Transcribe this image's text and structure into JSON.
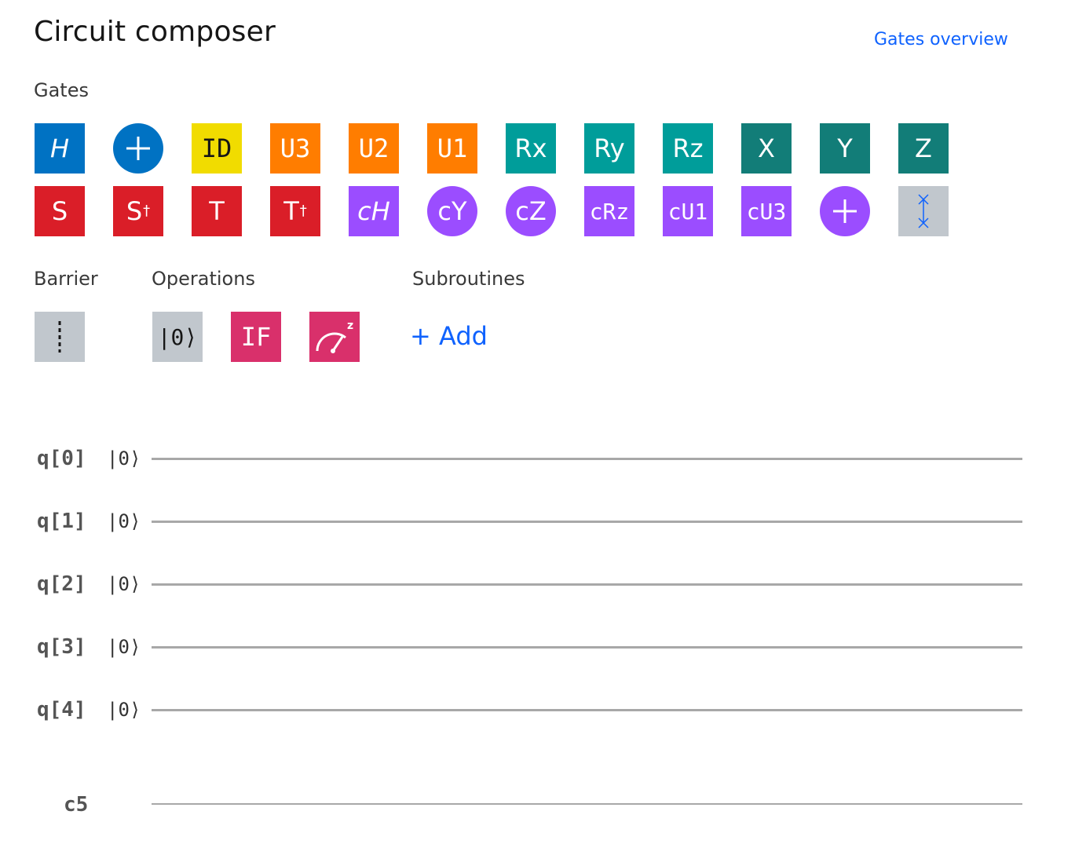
{
  "header": {
    "title": "Circuit composer",
    "overview_link": "Gates overview"
  },
  "sections": {
    "gates": "Gates",
    "barrier": "Barrier",
    "operations": "Operations",
    "subroutines": "Subroutines"
  },
  "gates_row1": [
    {
      "label": "H",
      "color": "#0072c3"
    },
    {
      "label": "+",
      "color": "#0072c3"
    },
    {
      "label": "ID",
      "color": "#f1dc00"
    },
    {
      "label": "U3",
      "color": "#ff7d00"
    },
    {
      "label": "U2",
      "color": "#ff7d00"
    },
    {
      "label": "U1",
      "color": "#ff7d00"
    },
    {
      "label": "Rx",
      "color": "#009d9a"
    },
    {
      "label": "Ry",
      "color": "#009d9a"
    },
    {
      "label": "Rz",
      "color": "#009d9a"
    },
    {
      "label": "X",
      "color": "#127d78"
    },
    {
      "label": "Y",
      "color": "#127d78"
    },
    {
      "label": "Z",
      "color": "#127d78"
    }
  ],
  "gates_row2": [
    {
      "label": "S",
      "color": "#da1e28"
    },
    {
      "label": "S",
      "sup": "†",
      "color": "#da1e28"
    },
    {
      "label": "T",
      "color": "#da1e28"
    },
    {
      "label": "T",
      "sup": "†",
      "color": "#da1e28"
    },
    {
      "label": "cH",
      "color": "#9b4dff"
    },
    {
      "label": "cY",
      "color": "#9b4dff"
    },
    {
      "label": "cZ",
      "color": "#9b4dff"
    },
    {
      "label": "cRz",
      "color": "#9b4dff"
    },
    {
      "label": "cU1",
      "color": "#9b4dff"
    },
    {
      "label": "cU3",
      "color": "#9b4dff"
    },
    {
      "label": "+",
      "color": "#9b4dff"
    },
    {
      "label": "swap-icon",
      "color": "#c1c7cd"
    }
  ],
  "operations": [
    {
      "label": "|0⟩",
      "color": "#c1c7cd"
    },
    {
      "label": "IF",
      "color": "#d9306b"
    },
    {
      "label": "measure-icon",
      "color": "#d9306b"
    }
  ],
  "barrier_color": "#c1c7cd",
  "subroutines_add": "+ Add",
  "qubits": [
    {
      "label": "q[0]",
      "ket": "|0⟩"
    },
    {
      "label": "q[1]",
      "ket": "|0⟩"
    },
    {
      "label": "q[2]",
      "ket": "|0⟩"
    },
    {
      "label": "q[3]",
      "ket": "|0⟩"
    },
    {
      "label": "q[4]",
      "ket": "|0⟩"
    }
  ],
  "classical": {
    "label": "c5"
  }
}
